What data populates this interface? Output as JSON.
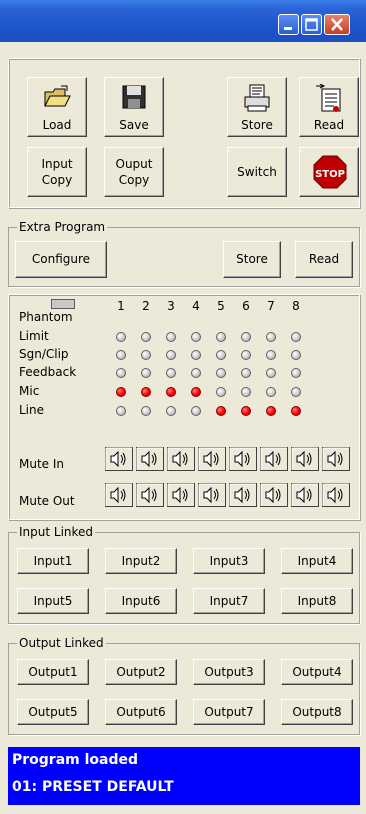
{
  "main_buttons": {
    "load": "Load",
    "save": "Save",
    "store": "Store",
    "read": "Read",
    "input_copy_l1": "Input",
    "input_copy_l2": "Copy",
    "output_copy_l1": "Ouput",
    "output_copy_l2": "Copy",
    "switch": "Switch",
    "stop": "STOP"
  },
  "extra_program": {
    "title": "Extra Program",
    "configure": "Configure",
    "store": "Store",
    "read": "Read"
  },
  "matrix": {
    "columns": [
      "1",
      "2",
      "3",
      "4",
      "5",
      "6",
      "7",
      "8"
    ],
    "rows": [
      {
        "label": "Phantom"
      },
      {
        "label": "Limit",
        "states": [
          0,
          0,
          0,
          0,
          0,
          0,
          0,
          0
        ]
      },
      {
        "label": "Sgn/Clip",
        "states": [
          0,
          0,
          0,
          0,
          0,
          0,
          0,
          0
        ]
      },
      {
        "label": "Feedback",
        "states": [
          0,
          0,
          0,
          0,
          0,
          0,
          0,
          0
        ]
      },
      {
        "label": "Mic",
        "states": [
          1,
          1,
          1,
          1,
          0,
          0,
          0,
          0
        ]
      },
      {
        "label": "Line",
        "states": [
          0,
          0,
          0,
          0,
          1,
          1,
          1,
          1
        ]
      }
    ],
    "mute_in": "Mute In",
    "mute_out": "Mute Out"
  },
  "input_linked": {
    "title": "Input Linked",
    "buttons": [
      "Input1",
      "Input2",
      "Input3",
      "Input4",
      "Input5",
      "Input6",
      "Input7",
      "Input8"
    ]
  },
  "output_linked": {
    "title": "Output Linked",
    "buttons": [
      "Output1",
      "Output2",
      "Output3",
      "Output4",
      "Output5",
      "Output6",
      "Output7",
      "Output8"
    ]
  },
  "status": {
    "line1": "Program loaded",
    "line2": "01: PRESET DEFAULT"
  },
  "colors": {
    "status_bg": "#0000ff",
    "led_on": "#ff0000",
    "title_bar": "#1f56cc",
    "stop_sign": "#c00000"
  }
}
